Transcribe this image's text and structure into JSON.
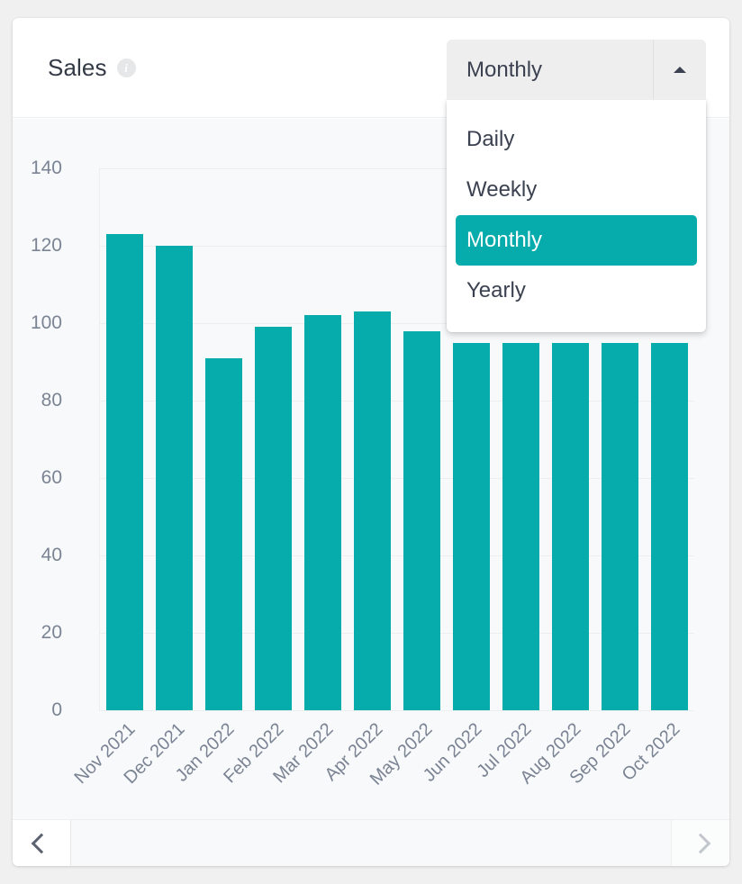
{
  "card": {
    "title": "Sales",
    "info_icon": "info-icon",
    "info_icon_glyph": "i"
  },
  "dropdown": {
    "selected": "Monthly",
    "expanded": true,
    "caret_icon": "caret-up-icon",
    "options": [
      {
        "label": "Daily",
        "selected": false
      },
      {
        "label": "Weekly",
        "selected": false
      },
      {
        "label": "Monthly",
        "selected": true
      },
      {
        "label": "Yearly",
        "selected": false
      }
    ]
  },
  "footer": {
    "prev_icon": "chevron-left-icon",
    "next_icon": "chevron-right-icon",
    "prev_enabled": true,
    "next_enabled": false
  },
  "colors": {
    "accent": "#06ABAB",
    "plot_background": "#f8f9fa",
    "gridline": "#eceef0",
    "tick_text": "#7b8494",
    "title_text": "#343a46"
  },
  "chart_data": {
    "type": "bar",
    "title": "Sales",
    "xlabel": "",
    "ylabel": "",
    "ylim": [
      0,
      140
    ],
    "yticks": [
      0,
      20,
      40,
      60,
      80,
      100,
      120,
      140
    ],
    "grid": true,
    "legend": "none",
    "xtick_rotation": -45,
    "categories": [
      "Nov 2021",
      "Dec 2021",
      "Jan 2022",
      "Feb 2022",
      "Mar 2022",
      "Apr 2022",
      "May 2022",
      "Jun 2022",
      "Jul 2022",
      "Aug 2022",
      "Sep 2022",
      "Oct 2022"
    ],
    "values": [
      123,
      120,
      91,
      99,
      102,
      103,
      98,
      95,
      95,
      95,
      95,
      95
    ],
    "series": [
      {
        "name": "Sales",
        "color": "#06ABAB",
        "values": [
          123,
          120,
          91,
          99,
          102,
          103,
          98,
          95,
          95,
          95,
          95,
          95
        ]
      }
    ],
    "notes": "Bars for Jun 2022 through Oct 2022 are partially occluded by the open dropdown menu; their tops are not visible."
  }
}
